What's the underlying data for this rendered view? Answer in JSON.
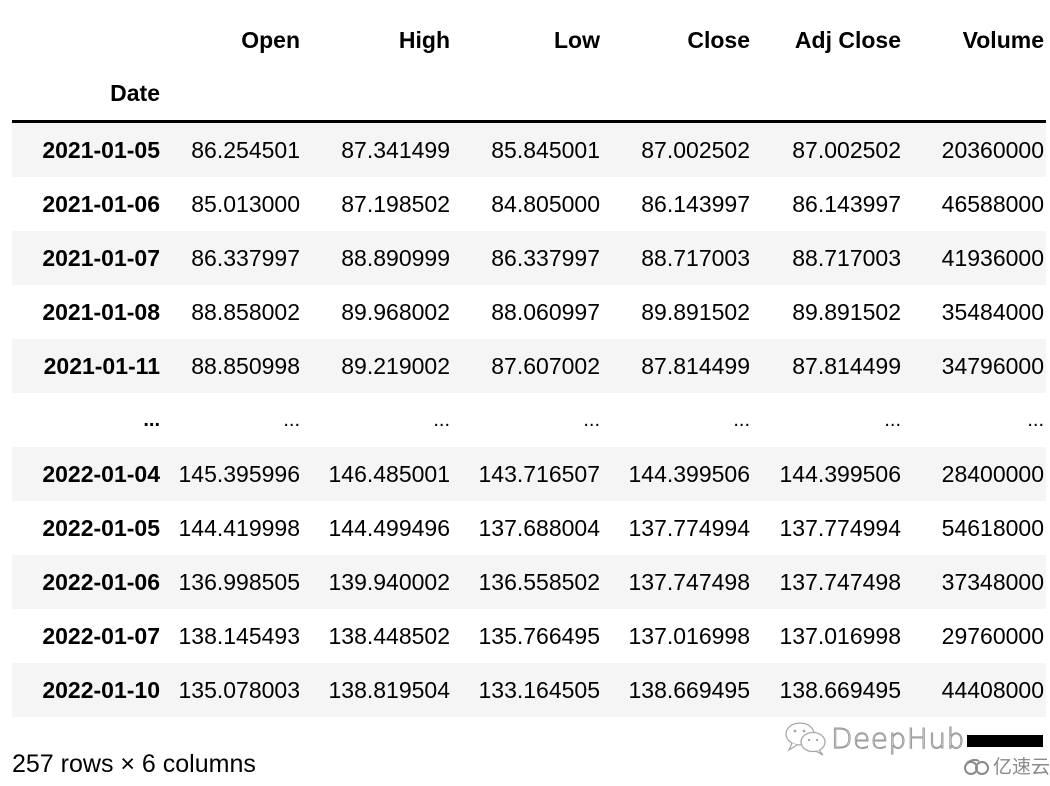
{
  "dataframe": {
    "index_name": "Date",
    "columns": [
      "Open",
      "High",
      "Low",
      "Close",
      "Adj Close",
      "Volume"
    ],
    "rows": [
      {
        "index": "2021-01-05",
        "values": [
          "86.254501",
          "87.341499",
          "85.845001",
          "87.002502",
          "87.002502",
          "20360000"
        ]
      },
      {
        "index": "2021-01-06",
        "values": [
          "85.013000",
          "87.198502",
          "84.805000",
          "86.143997",
          "86.143997",
          "46588000"
        ]
      },
      {
        "index": "2021-01-07",
        "values": [
          "86.337997",
          "88.890999",
          "86.337997",
          "88.717003",
          "88.717003",
          "41936000"
        ]
      },
      {
        "index": "2021-01-08",
        "values": [
          "88.858002",
          "89.968002",
          "88.060997",
          "89.891502",
          "89.891502",
          "35484000"
        ]
      },
      {
        "index": "2021-01-11",
        "values": [
          "88.850998",
          "89.219002",
          "87.607002",
          "87.814499",
          "87.814499",
          "34796000"
        ]
      },
      {
        "index": "...",
        "values": [
          "...",
          "...",
          "...",
          "...",
          "...",
          "..."
        ]
      },
      {
        "index": "2022-01-04",
        "values": [
          "145.395996",
          "146.485001",
          "143.716507",
          "144.399506",
          "144.399506",
          "28400000"
        ]
      },
      {
        "index": "2022-01-05",
        "values": [
          "144.419998",
          "144.499496",
          "137.688004",
          "137.774994",
          "137.774994",
          "54618000"
        ]
      },
      {
        "index": "2022-01-06",
        "values": [
          "136.998505",
          "139.940002",
          "136.558502",
          "137.747498",
          "137.747498",
          "37348000"
        ]
      },
      {
        "index": "2022-01-07",
        "values": [
          "138.145493",
          "138.448502",
          "135.766495",
          "137.016998",
          "137.016998",
          "29760000"
        ]
      },
      {
        "index": "2022-01-10",
        "values": [
          "135.078003",
          "138.819504",
          "133.164505",
          "138.669495",
          "138.669495",
          "44408000"
        ]
      }
    ],
    "shape_caption": "257 rows × 6 columns"
  },
  "watermarks": {
    "primary_text": "DeepHub",
    "primary_icon": "wechat-icon",
    "secondary_text": "亿速云",
    "secondary_icon": "cloud-logo-icon"
  },
  "colors": {
    "stripe": "#f5f5f5",
    "header_rule": "#000000",
    "text": "#000000",
    "watermark": "#9a9a9a"
  }
}
